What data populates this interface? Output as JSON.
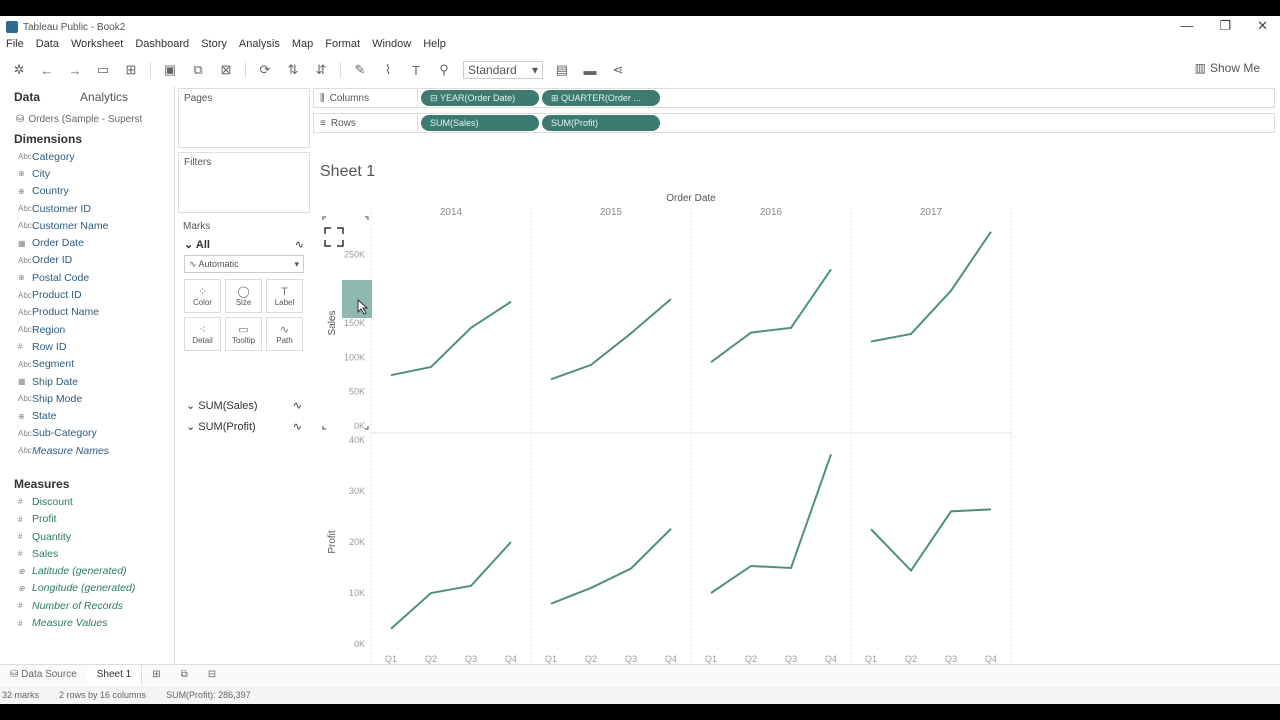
{
  "window": {
    "title": "Tableau Public - Book2",
    "controls": [
      "—",
      "❐",
      "✕"
    ]
  },
  "menu": [
    "File",
    "Data",
    "Worksheet",
    "Dashboard",
    "Story",
    "Analysis",
    "Map",
    "Format",
    "Window",
    "Help"
  ],
  "toolbar": {
    "fit_select": "Standard",
    "show_me": "Show Me"
  },
  "data_pane": {
    "tab_data": "Data",
    "tab_analytics": "Analytics",
    "datasource": "Orders (Sample - Superst",
    "dimensions_title": "Dimensions",
    "dimensions": [
      {
        "icon": "Abc",
        "label": "Category"
      },
      {
        "icon": "⊕",
        "label": "City"
      },
      {
        "icon": "⊕",
        "label": "Country"
      },
      {
        "icon": "Abc",
        "label": "Customer ID"
      },
      {
        "icon": "Abc",
        "label": "Customer Name"
      },
      {
        "icon": "▦",
        "label": "Order Date"
      },
      {
        "icon": "Abc",
        "label": "Order ID"
      },
      {
        "icon": "⊕",
        "label": "Postal Code"
      },
      {
        "icon": "Abc",
        "label": "Product ID"
      },
      {
        "icon": "Abc",
        "label": "Product Name"
      },
      {
        "icon": "Abc",
        "label": "Region"
      },
      {
        "icon": "#",
        "label": "Row ID"
      },
      {
        "icon": "Abc",
        "label": "Segment"
      },
      {
        "icon": "▦",
        "label": "Ship Date"
      },
      {
        "icon": "Abc",
        "label": "Ship Mode"
      },
      {
        "icon": "⊕",
        "label": "State"
      },
      {
        "icon": "Abc",
        "label": "Sub-Category"
      },
      {
        "icon": "Abc",
        "label": "Measure Names",
        "italic": true
      }
    ],
    "measures_title": "Measures",
    "measures": [
      {
        "icon": "#",
        "label": "Discount"
      },
      {
        "icon": "#",
        "label": "Profit"
      },
      {
        "icon": "#",
        "label": "Quantity"
      },
      {
        "icon": "#",
        "label": "Sales"
      },
      {
        "icon": "⊕",
        "label": "Latitude (generated)",
        "italic": true
      },
      {
        "icon": "⊕",
        "label": "Longitude (generated)",
        "italic": true
      },
      {
        "icon": "#",
        "label": "Number of Records",
        "italic": true
      },
      {
        "icon": "#",
        "label": "Measure Values",
        "italic": true
      }
    ]
  },
  "cards": {
    "pages": "Pages",
    "filters": "Filters",
    "marks": "Marks",
    "marks_all": "All",
    "mark_type": "Automatic",
    "buttons": [
      {
        "icon": "⁘",
        "label": "Color"
      },
      {
        "icon": "◯",
        "label": "Size"
      },
      {
        "icon": "T",
        "label": "Label"
      },
      {
        "icon": "⁖",
        "label": "Detail"
      },
      {
        "icon": "▭",
        "label": "Tooltip"
      },
      {
        "icon": "∿",
        "label": "Path"
      }
    ],
    "measure_rows": [
      "SUM(Sales)",
      "SUM(Profit)"
    ]
  },
  "shelves": {
    "columns_label": "Columns",
    "rows_label": "Rows",
    "columns_pills": [
      "YEAR(Order Date)",
      "QUARTER(Order ..."
    ],
    "rows_pills": [
      "SUM(Sales)",
      "SUM(Profit)"
    ]
  },
  "sheet_title": "Sheet 1",
  "bottom_tabs": [
    "Data Source",
    "Sheet 1"
  ],
  "status": {
    "marks": "32 marks",
    "rows_cols": "2 rows by 16 columns",
    "sum": "SUM(Profit): 286,397"
  },
  "colors": {
    "line": "#4f8f82",
    "pill": "#3d7a6f",
    "dimension_text": "#2b5c7d"
  },
  "chart_data": {
    "type": "line",
    "header": "Order Date",
    "years": [
      "2014",
      "2015",
      "2016",
      "2017"
    ],
    "quarters": [
      "Q1",
      "Q2",
      "Q3",
      "Q4"
    ],
    "panes": [
      {
        "measure": "Sales",
        "ylabel": "Sales",
        "ylim": [
          0,
          300000
        ],
        "ticks": [
          {
            "v": 0,
            "label": "0K"
          },
          {
            "v": 50000,
            "label": "50K"
          },
          {
            "v": 100000,
            "label": "100K"
          },
          {
            "v": 150000,
            "label": "150K"
          },
          {
            "v": 250000,
            "label": "250K"
          }
        ],
        "series": [
          {
            "year": "2014",
            "values": [
              74000,
              86000,
              143000,
              181000
            ]
          },
          {
            "year": "2015",
            "values": [
              68000,
              89000,
              135000,
              185000
            ]
          },
          {
            "year": "2016",
            "values": [
              93000,
              136000,
              143000,
              228000
            ]
          },
          {
            "year": "2017",
            "values": [
              123000,
              134000,
              197000,
              283000
            ]
          }
        ]
      },
      {
        "measure": "Profit",
        "ylabel": "Profit",
        "ylim": [
          0,
          40000
        ],
        "ticks": [
          {
            "v": 0,
            "label": "0K"
          },
          {
            "v": 10000,
            "label": "10K"
          },
          {
            "v": 20000,
            "label": "20K"
          },
          {
            "v": 30000,
            "label": "30K"
          },
          {
            "v": 40000,
            "label": "40K"
          }
        ],
        "series": [
          {
            "year": "2014",
            "values": [
              3000,
              10000,
              11400,
              20000
            ]
          },
          {
            "year": "2015",
            "values": [
              7900,
              11000,
              14800,
              22600
            ]
          },
          {
            "year": "2016",
            "values": [
              10000,
              15300,
              14900,
              37200
            ]
          },
          {
            "year": "2017",
            "values": [
              22500,
              14400,
              26000,
              26400
            ]
          }
        ]
      }
    ]
  }
}
